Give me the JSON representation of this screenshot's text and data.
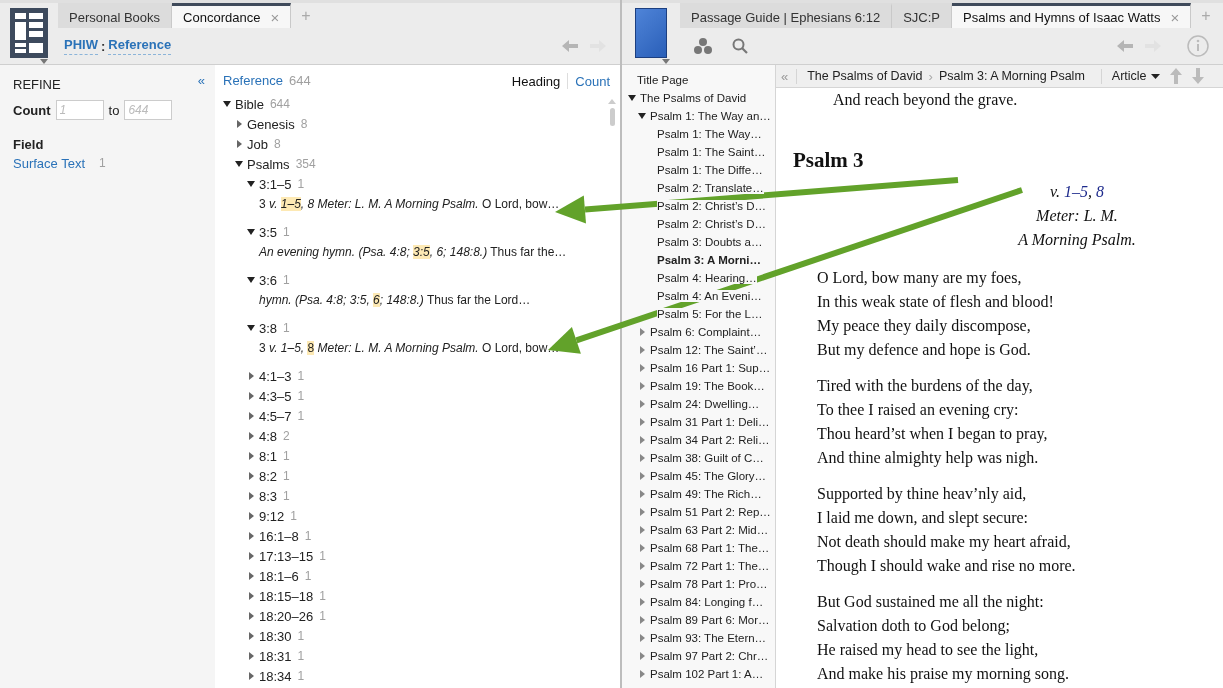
{
  "left_panel": {
    "close_glyph": "×",
    "add_glyph": "+",
    "tabs": [
      {
        "label": "Personal Books",
        "selected": false,
        "closable": false
      },
      {
        "label": "Concordance",
        "selected": true,
        "closable": true
      }
    ],
    "breadcrumb": {
      "source": "PHIW",
      "separator": ":",
      "field": "Reference"
    },
    "refine": {
      "collapse_glyph": "«",
      "title": "REFINE",
      "count_label": "Count",
      "from_placeholder": "1",
      "to_label": "to",
      "to_placeholder": "644",
      "field_heading": "Field",
      "fields": [
        {
          "label": "Surface Text",
          "count": "1"
        }
      ]
    },
    "results": {
      "header": {
        "label": "Reference",
        "count": "644"
      },
      "views": [
        {
          "label": "Heading",
          "selected": true
        },
        {
          "label": "Count",
          "selected": false
        }
      ],
      "tree": [
        {
          "label": "Bible",
          "count": "644",
          "expanded": true,
          "children": [
            {
              "label": "Genesis",
              "count": "8",
              "expanded": false
            },
            {
              "label": "Job",
              "count": "8",
              "expanded": false
            },
            {
              "label": "Psalms",
              "count": "354",
              "expanded": true,
              "children": [
                {
                  "label": "3:1–5",
                  "count": "1",
                  "expanded": true,
                  "snippet": [
                    {
                      "text": "3 ",
                      "italic": false,
                      "highlight": false
                    },
                    {
                      "text": "v. ",
                      "italic": true,
                      "highlight": false
                    },
                    {
                      "text": "1–5",
                      "italic": true,
                      "highlight": true
                    },
                    {
                      "text": ", 8 Meter: L. M. A Morning Psalm.",
                      "italic": true,
                      "highlight": false
                    },
                    {
                      "text": " O Lord, bow…",
                      "italic": false,
                      "highlight": false
                    }
                  ]
                },
                {
                  "label": "3:5",
                  "count": "1",
                  "expanded": true,
                  "snippet": [
                    {
                      "text": "An evening hymn. (Psa. 4:8; ",
                      "italic": true,
                      "highlight": false
                    },
                    {
                      "text": "3:5",
                      "italic": true,
                      "highlight": true
                    },
                    {
                      "text": ", 6; 148:8.)",
                      "italic": true,
                      "highlight": false
                    },
                    {
                      "text": " Thus far the…",
                      "italic": false,
                      "highlight": false
                    }
                  ]
                },
                {
                  "label": "3:6",
                  "count": "1",
                  "expanded": true,
                  "snippet": [
                    {
                      "text": "hymn. (Psa. 4:8; 3:5, ",
                      "italic": true,
                      "highlight": false
                    },
                    {
                      "text": "6",
                      "italic": true,
                      "highlight": true
                    },
                    {
                      "text": "; 148:8.)",
                      "italic": true,
                      "highlight": false
                    },
                    {
                      "text": " Thus far the Lord…",
                      "italic": false,
                      "highlight": false
                    }
                  ]
                },
                {
                  "label": "3:8",
                  "count": "1",
                  "expanded": true,
                  "snippet": [
                    {
                      "text": "3 ",
                      "italic": false,
                      "highlight": false
                    },
                    {
                      "text": "v. 1–5, ",
                      "italic": true,
                      "highlight": false
                    },
                    {
                      "text": "8",
                      "italic": false,
                      "highlight": true
                    },
                    {
                      "text": " Meter: L. M. A Morning Psalm.",
                      "italic": true,
                      "highlight": false
                    },
                    {
                      "text": " O Lord, bow…",
                      "italic": false,
                      "highlight": false
                    }
                  ]
                },
                {
                  "label": "4:1–3",
                  "count": "1",
                  "expanded": false
                },
                {
                  "label": "4:3–5",
                  "count": "1",
                  "expanded": false
                },
                {
                  "label": "4:5–7",
                  "count": "1",
                  "expanded": false
                },
                {
                  "label": "4:8",
                  "count": "2",
                  "expanded": false
                },
                {
                  "label": "8:1",
                  "count": "1",
                  "expanded": false
                },
                {
                  "label": "8:2",
                  "count": "1",
                  "expanded": false
                },
                {
                  "label": "8:3",
                  "count": "1",
                  "expanded": false
                },
                {
                  "label": "9:12",
                  "count": "1",
                  "expanded": false
                },
                {
                  "label": "16:1–8",
                  "count": "1",
                  "expanded": false
                },
                {
                  "label": "17:13–15",
                  "count": "1",
                  "expanded": false
                },
                {
                  "label": "18:1–6",
                  "count": "1",
                  "expanded": false
                },
                {
                  "label": "18:15–18",
                  "count": "1",
                  "expanded": false
                },
                {
                  "label": "18:20–26",
                  "count": "1",
                  "expanded": false
                },
                {
                  "label": "18:30",
                  "count": "1",
                  "expanded": false
                },
                {
                  "label": "18:31",
                  "count": "1",
                  "expanded": false
                },
                {
                  "label": "18:34",
                  "count": "1",
                  "expanded": false
                }
              ]
            }
          ]
        }
      ]
    }
  },
  "right_panel": {
    "close_glyph": "×",
    "add_glyph": "+",
    "tabs": [
      {
        "label": "Passage Guide | Ephesians 6:12",
        "selected": false,
        "closable": false
      },
      {
        "label": "SJC:P",
        "selected": false,
        "closable": false
      },
      {
        "label": "Psalms and Hymns of Isaac Watts",
        "selected": true,
        "closable": true
      }
    ],
    "reader_toolbar": {
      "collapse_glyph": "«",
      "breadcrumb": [
        "The Psalms of David",
        "Psalm 3: A Morning Psalm"
      ],
      "breadcrumb_separator": "›",
      "view_menu": "Article"
    },
    "toc": [
      {
        "label": "Title Page",
        "selected": false
      },
      {
        "label": "The Psalms of David",
        "selected": false,
        "expanded": true,
        "children": [
          {
            "label": "Psalm 1: The Way an…",
            "selected": false,
            "expanded": true,
            "children": [
              {
                "label": "Psalm 1: The Way…",
                "selected": false
              },
              {
                "label": "Psalm 1: The Saint…",
                "selected": false
              },
              {
                "label": "Psalm 1: The Diffe…",
                "selected": false
              },
              {
                "label": "Psalm 2: Translate…",
                "selected": false
              },
              {
                "label": "Psalm 2: Christ’s D…",
                "selected": false
              },
              {
                "label": "Psalm 2: Christ’s D…",
                "selected": false
              },
              {
                "label": "Psalm 3: Doubts a…",
                "selected": false
              },
              {
                "label": "Psalm 3: A Morni…",
                "selected": true
              },
              {
                "label": "Psalm 4: Hearing…",
                "selected": false
              },
              {
                "label": "Psalm 4: An Eveni…",
                "selected": false
              },
              {
                "label": "Psalm 5: For the L…",
                "selected": false
              }
            ]
          },
          {
            "label": "Psalm 6: Complaint…",
            "selected": false,
            "expanded": false
          },
          {
            "label": "Psalm 12: The Saint’…",
            "selected": false,
            "expanded": false
          },
          {
            "label": "Psalm 16 Part 1: Sup…",
            "selected": false,
            "expanded": false
          },
          {
            "label": "Psalm 19: The Book…",
            "selected": false,
            "expanded": false
          },
          {
            "label": "Psalm 24: Dwelling…",
            "selected": false,
            "expanded": false
          },
          {
            "label": "Psalm 31 Part 1: Deli…",
            "selected": false,
            "expanded": false
          },
          {
            "label": "Psalm 34 Part 2: Reli…",
            "selected": false,
            "expanded": false
          },
          {
            "label": "Psalm 38: Guilt of C…",
            "selected": false,
            "expanded": false
          },
          {
            "label": "Psalm 45: The Glory…",
            "selected": false,
            "expanded": false
          },
          {
            "label": "Psalm 49: The Rich…",
            "selected": false,
            "expanded": false
          },
          {
            "label": "Psalm 51 Part 2: Rep…",
            "selected": false,
            "expanded": false
          },
          {
            "label": "Psalm 63 Part 2: Mid…",
            "selected": false,
            "expanded": false
          },
          {
            "label": "Psalm 68 Part 1: The…",
            "selected": false,
            "expanded": false
          },
          {
            "label": "Psalm 72 Part 1: The…",
            "selected": false,
            "expanded": false
          },
          {
            "label": "Psalm 78 Part 1: Pro…",
            "selected": false,
            "expanded": false
          },
          {
            "label": "Psalm 84: Longing f…",
            "selected": false,
            "expanded": false
          },
          {
            "label": "Psalm 89 Part 6: Mor…",
            "selected": false,
            "expanded": false
          },
          {
            "label": "Psalm 93: The Etern…",
            "selected": false,
            "expanded": false
          },
          {
            "label": "Psalm 97 Part 2: Chr…",
            "selected": false,
            "expanded": false
          },
          {
            "label": "Psalm 102 Part 1: A…",
            "selected": false,
            "expanded": false
          }
        ]
      }
    ],
    "article": {
      "previous_line": "And reach beyond the grave.",
      "heading": "Psalm 3",
      "reference": [
        {
          "text": "v. ",
          "link": false
        },
        {
          "text": "1–5",
          "link": true
        },
        {
          "text": ", ",
          "link": false
        },
        {
          "text": "8",
          "link": true
        }
      ],
      "subtitles": [
        "Meter: L. M.",
        "A Morning Psalm."
      ],
      "stanzas": [
        [
          "O Lord, bow many are my foes,",
          "In this weak state of flesh and blood!",
          "My peace they daily discompose,",
          "But my defence and hope is God."
        ],
        [
          "Tired with the burdens of the day,",
          "To thee I raised an evening cry:",
          "Thou heard’st when I began to pray,",
          "And thine almighty help was nigh."
        ],
        [
          "Supported by thine heav’nly aid,",
          "I laid me down, and slept secure:",
          "Not death should make my heart afraid,",
          "Though I should wake and rise no more."
        ],
        [
          "But God sustained me all the night:",
          "Salvation doth to God belong;",
          "He raised my head to see the light,",
          "And make his praise my morning song."
        ]
      ]
    }
  }
}
